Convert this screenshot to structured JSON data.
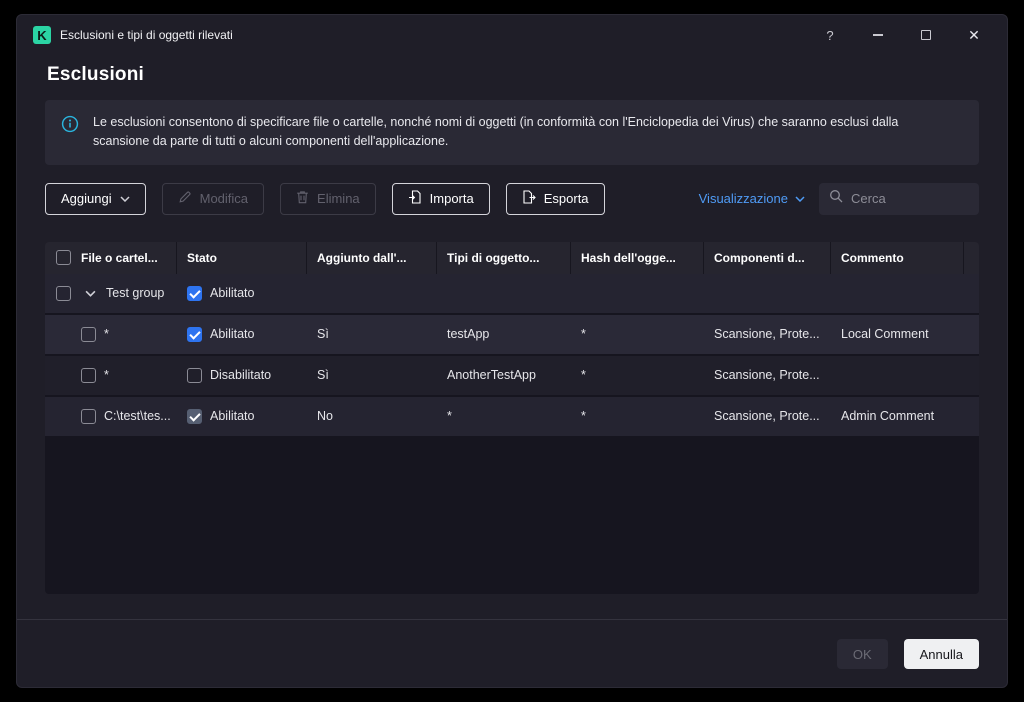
{
  "window": {
    "title": "Esclusioni e tipi di oggetti rilevati",
    "logo_letter": "K",
    "icons": {
      "help": "?",
      "close": "✕"
    }
  },
  "page": {
    "title": "Esclusioni",
    "info_text": "Le esclusioni consentono di specificare file o cartelle, nonché nomi di oggetti (in conformità con l'Enciclopedia dei Virus) che saranno esclusi dalla scansione da parte di tutti o alcuni componenti dell'applicazione."
  },
  "toolbar": {
    "add_label": "Aggiungi",
    "edit_label": "Modifica",
    "delete_label": "Elimina",
    "import_label": "Importa",
    "export_label": "Esporta",
    "view_label": "Visualizzazione",
    "search_placeholder": "Cerca"
  },
  "table": {
    "columns": [
      "File o cartel...",
      "Stato",
      "Aggiunto dall'...",
      "Tipi di oggetto...",
      "Hash dell'ogge...",
      "Componenti d...",
      "Commento"
    ],
    "group": {
      "name": "Test group",
      "status": "Abilitato",
      "enabled": true
    },
    "rows": [
      {
        "file": "*",
        "status": "Abilitato",
        "enabled": true,
        "added_by_user": "Sì",
        "object_type": "testApp",
        "hash": "*",
        "components": "Scansione, Prote...",
        "comment": "Local Comment"
      },
      {
        "file": "*",
        "status": "Disabilitato",
        "enabled": false,
        "added_by_user": "Sì",
        "object_type": "AnotherTestApp",
        "hash": "*",
        "components": "Scansione, Prote...",
        "comment": ""
      },
      {
        "file": "C:\\test\\tes...",
        "status": "Abilitato",
        "enabled": true,
        "added_by_user": "No",
        "object_type": "*",
        "hash": "*",
        "components": "Scansione, Prote...",
        "comment": "Admin Comment"
      }
    ]
  },
  "footer": {
    "ok_label": "OK",
    "cancel_label": "Annulla"
  },
  "colors": {
    "accent_checkbox": "#2e74f0",
    "link_blue": "#4f9bf5",
    "logo_green": "#2bd4a4",
    "info_icon": "#2ab4dd"
  }
}
